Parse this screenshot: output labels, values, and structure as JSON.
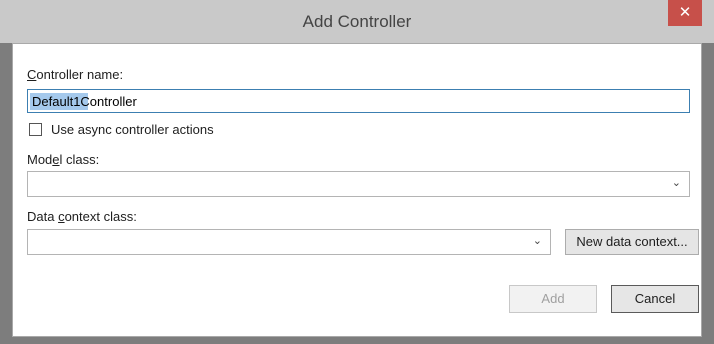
{
  "window": {
    "title": "Add Controller",
    "close_glyph": "✕"
  },
  "controller_name": {
    "label_accel": "C",
    "label_rest": "ontroller name:",
    "selected_text": "Default1",
    "rest_text": "Controller"
  },
  "async": {
    "label": "Use async controller actions",
    "checked": false
  },
  "model_class": {
    "label_pre": "Mod",
    "label_accel": "e",
    "label_post": "l class:",
    "value": ""
  },
  "data_context": {
    "label_pre": "Data ",
    "label_accel": "c",
    "label_post": "ontext class:",
    "value": ""
  },
  "buttons": {
    "new_context": "New data context...",
    "add": "Add",
    "cancel": "Cancel"
  },
  "icons": {
    "close": "close-icon",
    "dropdown": "chevron-down-icon",
    "dropdown_glyph": "⌄"
  }
}
